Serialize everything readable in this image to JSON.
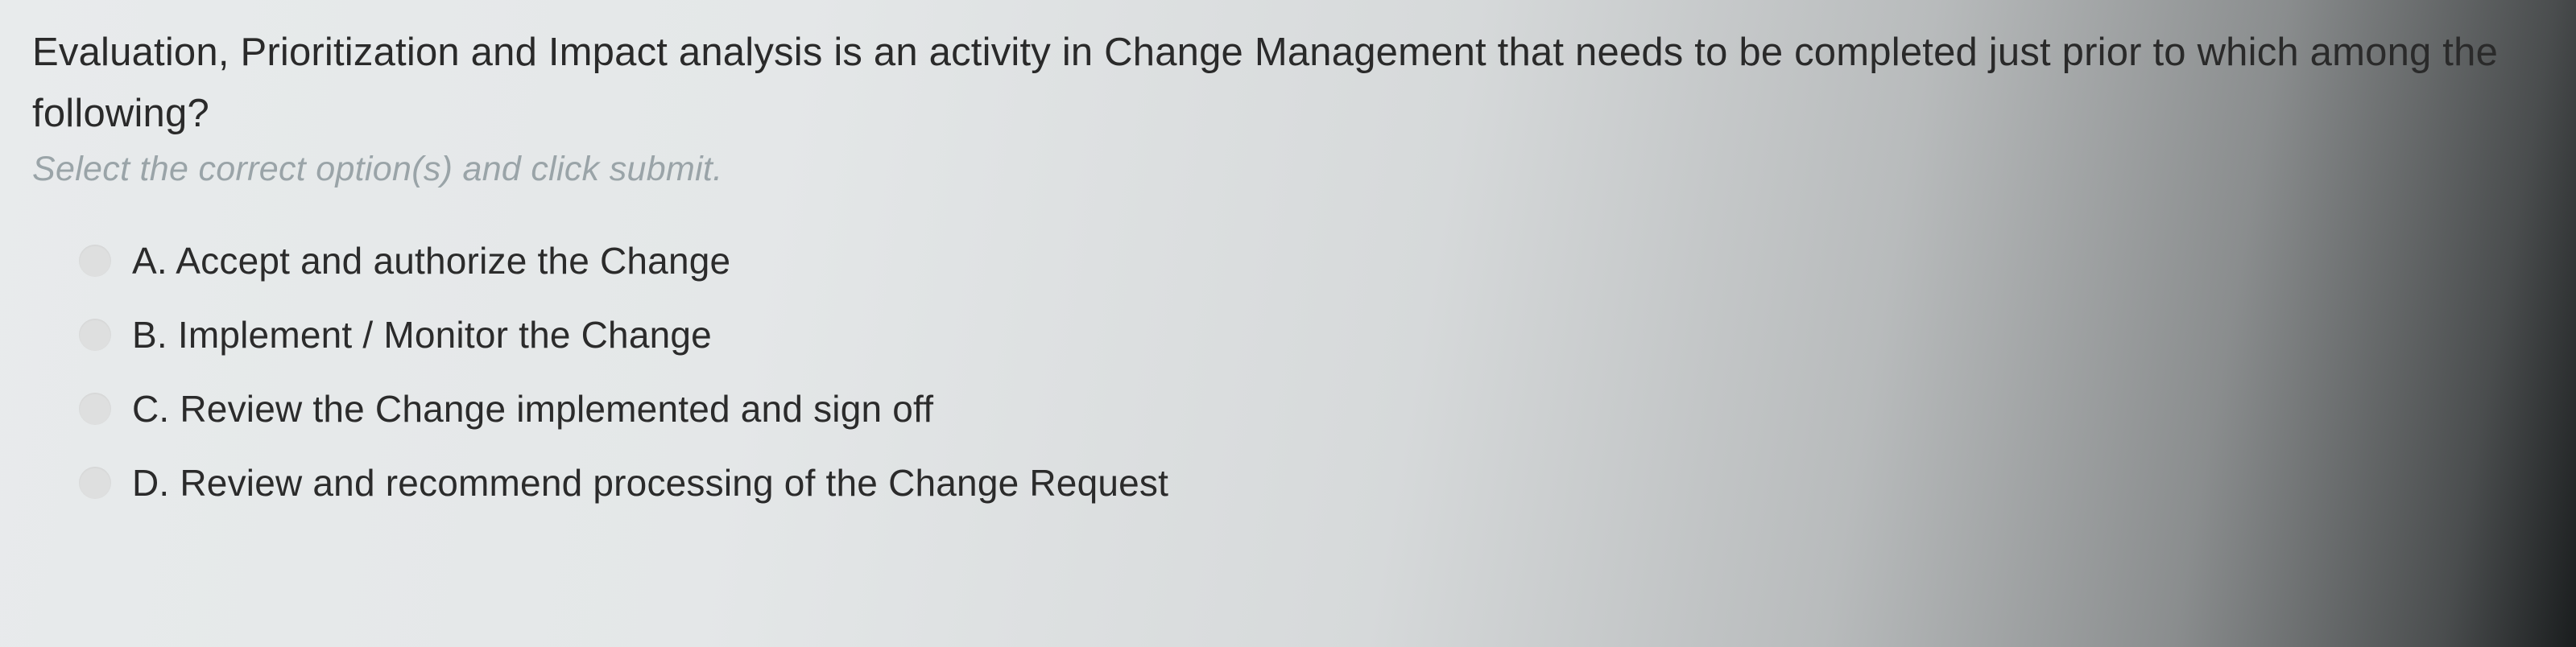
{
  "question": {
    "text": "Evaluation, Prioritization and Impact analysis is an activity in Change Management that needs to be completed just prior to which among the following?",
    "instruction": "Select the correct option(s) and click submit."
  },
  "options": [
    {
      "label": "A. Accept and authorize the Change"
    },
    {
      "label": "B. Implement / Monitor the Change"
    },
    {
      "label": "C. Review the Change implemented and sign off"
    },
    {
      "label": "D. Review and recommend processing of the Change Request"
    }
  ]
}
